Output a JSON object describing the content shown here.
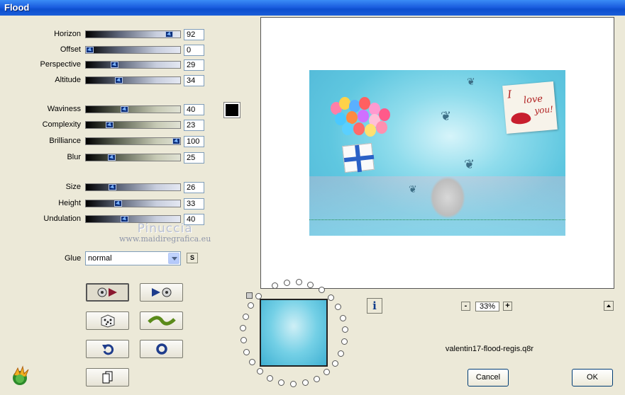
{
  "window": {
    "title": "Flood"
  },
  "sliders_group1": [
    {
      "label": "Horizon",
      "value": "92",
      "pct": 0.92
    },
    {
      "label": "Offset",
      "value": "0",
      "pct": 0.0
    },
    {
      "label": "Perspective",
      "value": "29",
      "pct": 0.29
    },
    {
      "label": "Altitude",
      "value": "34",
      "pct": 0.34
    }
  ],
  "sliders_group2": [
    {
      "label": "Waviness",
      "value": "40",
      "pct": 0.4
    },
    {
      "label": "Complexity",
      "value": "23",
      "pct": 0.23
    },
    {
      "label": "Brilliance",
      "value": "100",
      "pct": 1.0
    },
    {
      "label": "Blur",
      "value": "25",
      "pct": 0.25
    }
  ],
  "sliders_group3": [
    {
      "label": "Size",
      "value": "26",
      "pct": 0.26
    },
    {
      "label": "Height",
      "value": "33",
      "pct": 0.33
    },
    {
      "label": "Undulation",
      "value": "40",
      "pct": 0.4
    }
  ],
  "color_swatch": "#000000",
  "watermark": {
    "line1": "Pinuccia",
    "line2": "www.maidiregrafica.eu"
  },
  "glue": {
    "label": "Glue",
    "value": "normal",
    "small_button": "S"
  },
  "preview": {
    "note_line1": "I",
    "note_line2": "love",
    "note_line3": "you!"
  },
  "zoom": {
    "level": "33%",
    "minus": "-",
    "plus": "+"
  },
  "info_button": "i",
  "filename": "valentin17-flood-regis.q8r",
  "buttons": {
    "cancel": "Cancel",
    "ok": "OK"
  },
  "icons": [
    "prev-preset-icon",
    "next-preset-icon",
    "random-dice-icon",
    "wave-icon",
    "undo-icon",
    "reset-circle-icon",
    "copy-page-icon",
    "app-logo-icon"
  ]
}
